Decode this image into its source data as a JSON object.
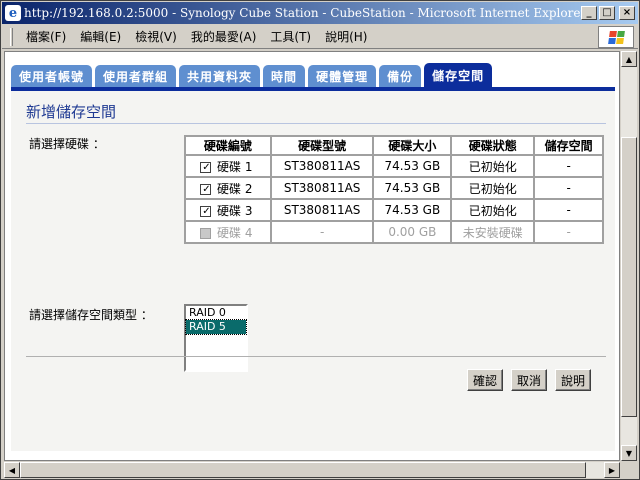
{
  "window": {
    "title": "http://192.168.0.2:5000 - Synology Cube Station - CubeStation - Microsoft Internet Explorer",
    "minimize": "_",
    "maximize": "□",
    "close": "×"
  },
  "menu": [
    "檔案(F)",
    "編輯(E)",
    "檢視(V)",
    "我的最愛(A)",
    "工具(T)",
    "說明(H)"
  ],
  "tabs": [
    {
      "label": "使用者帳號",
      "active": false
    },
    {
      "label": "使用者群組",
      "active": false
    },
    {
      "label": "共用資料夾",
      "active": false
    },
    {
      "label": "時間",
      "active": false
    },
    {
      "label": "硬體管理",
      "active": false
    },
    {
      "label": "備份",
      "active": false
    },
    {
      "label": "儲存空間",
      "active": true
    }
  ],
  "page": {
    "heading": "新增儲存空間",
    "select_disk_label": "請選擇硬碟 ：",
    "select_type_label": "請選擇儲存空間類型 ："
  },
  "disk_table": {
    "headers": [
      "硬碟編號",
      "硬碟型號",
      "硬碟大小",
      "硬碟狀態",
      "儲存空間"
    ],
    "rows": [
      {
        "number": "硬碟 1",
        "model": "ST380811AS",
        "size": "74.53 GB",
        "status": "已初始化",
        "volume": "-",
        "checked": true,
        "disabled": false
      },
      {
        "number": "硬碟 2",
        "model": "ST380811AS",
        "size": "74.53 GB",
        "status": "已初始化",
        "volume": "-",
        "checked": true,
        "disabled": false
      },
      {
        "number": "硬碟 3",
        "model": "ST380811AS",
        "size": "74.53 GB",
        "status": "已初始化",
        "volume": "-",
        "checked": true,
        "disabled": false
      },
      {
        "number": "硬碟 4",
        "model": "-",
        "size": "0.00 GB",
        "status": "未安裝硬碟",
        "volume": "-",
        "checked": false,
        "disabled": true
      }
    ]
  },
  "raid_options": {
    "items": [
      "RAID 0",
      "RAID 5"
    ],
    "selected": "RAID 5"
  },
  "buttons": {
    "confirm": "確認",
    "cancel": "取消",
    "help": "說明"
  },
  "colors": {
    "tab": "#5f8fd0",
    "tab_active": "#0c2d9c",
    "heading": "#1f3a93",
    "selected_option": "#0a6b6b"
  }
}
